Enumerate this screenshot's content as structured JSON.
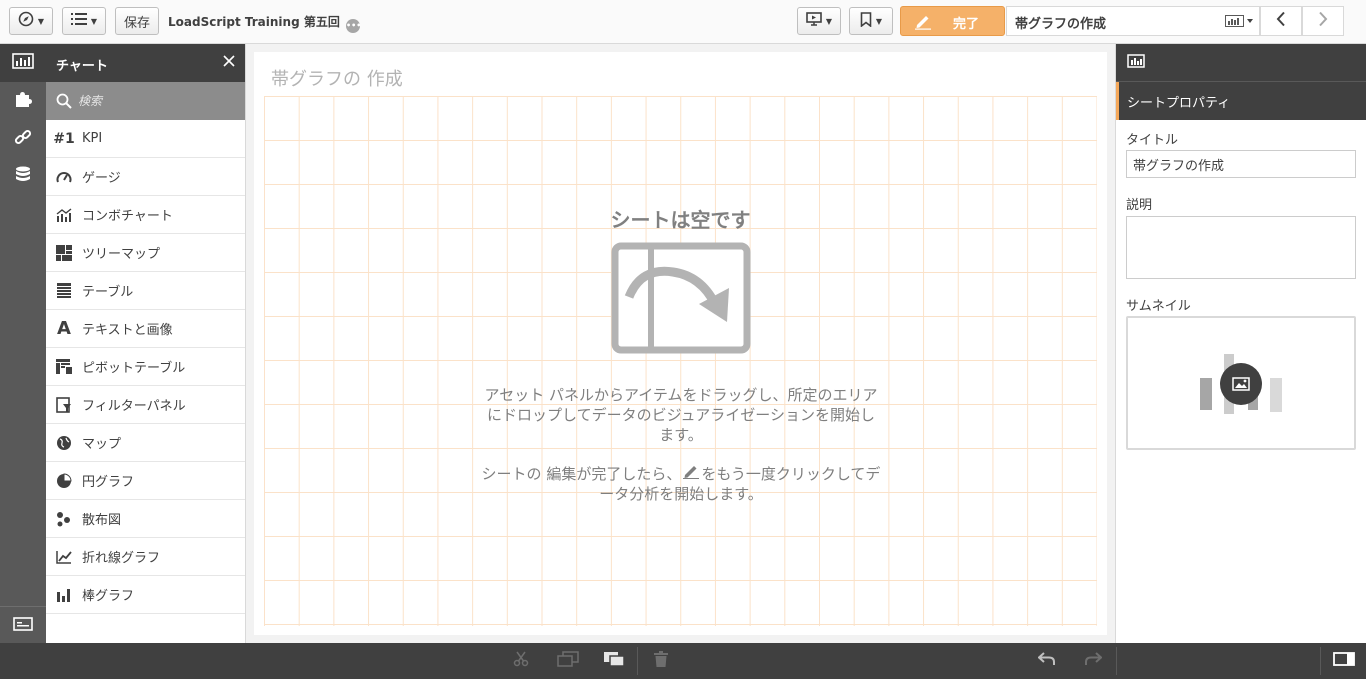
{
  "toolbar": {
    "save_label": "保存",
    "app_title": "LoadScript Training 第五回",
    "app_title_badge": "•••",
    "done_label": "完了",
    "current_sheet": "帯グラフの作成"
  },
  "assets": {
    "header": "チャート",
    "search_placeholder": "検索",
    "items": [
      {
        "label": "KPI",
        "icon": "kpi-icon",
        "glyph": "#1"
      },
      {
        "label": "ゲージ",
        "icon": "gauge-icon"
      },
      {
        "label": "コンボチャート",
        "icon": "combo-chart-icon"
      },
      {
        "label": "ツリーマップ",
        "icon": "treemap-icon"
      },
      {
        "label": "テーブル",
        "icon": "table-icon"
      },
      {
        "label": "テキストと画像",
        "icon": "text-image-icon",
        "glyph": "A"
      },
      {
        "label": "ピボットテーブル",
        "icon": "pivot-table-icon"
      },
      {
        "label": "フィルターパネル",
        "icon": "filter-pane-icon"
      },
      {
        "label": "マップ",
        "icon": "map-icon"
      },
      {
        "label": "円グラフ",
        "icon": "pie-chart-icon"
      },
      {
        "label": "散布図",
        "icon": "scatter-plot-icon"
      },
      {
        "label": "折れ線グラフ",
        "icon": "line-chart-icon"
      },
      {
        "label": "棒グラフ",
        "icon": "bar-chart-icon"
      }
    ]
  },
  "canvas": {
    "sheet_title": "帯グラフの 作成",
    "empty_title": "シートは空です",
    "empty_text_1": "アセット パネルからアイテムをドラッグし、所定のエリアにドロップしてデータのビジュアライゼーションを開始します。",
    "empty_text_2a": "シートの 編集が完了したら、",
    "empty_text_2b": "をもう一度クリックしてデータ分析を開始します。"
  },
  "properties": {
    "header": "シートプロパティ",
    "title_label": "タイトル",
    "title_value": "帯グラフの作成",
    "description_label": "説明",
    "description_value": "",
    "thumbnail_label": "サムネイル"
  },
  "colors": {
    "accent": "#f5b169",
    "dark": "#404040",
    "grid": "#fbe2c9"
  }
}
